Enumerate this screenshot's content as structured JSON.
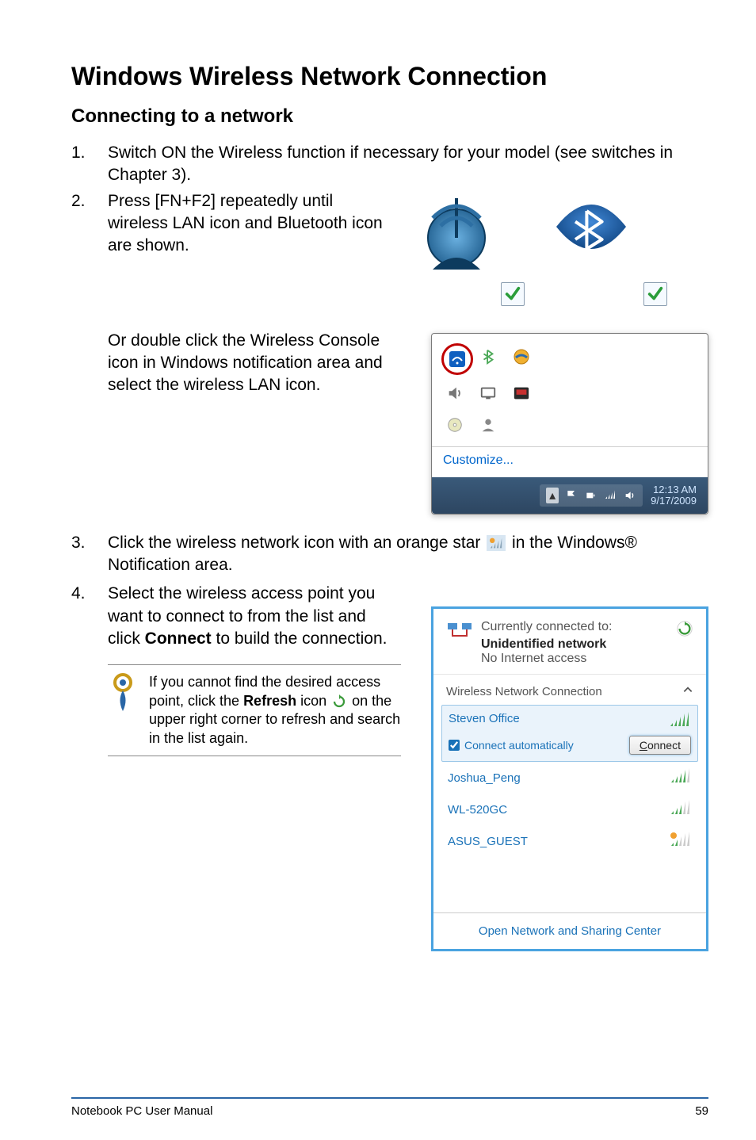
{
  "title": "Windows Wireless Network Connection",
  "subtitle": "Connecting to a network",
  "steps": {
    "s1_num": "1.",
    "s1_text": "Switch ON the Wireless function if necessary for your model (see switches in Chapter 3).",
    "s2_num": "2.",
    "s2_text": "Press [FN+F2] repeatedly until wireless LAN icon and Bluetooth icon are shown.",
    "s2_alt": "Or double click the Wireless Console icon in Windows notification area and select the wireless LAN icon.",
    "s3_num": "3.",
    "s3_text_before": "Click the wireless network icon with an orange star ",
    "s3_text_after": " in the Windows® Notification area.",
    "s4_num": "4.",
    "s4_text_a": "Select the wireless access point you want to connect to from the list and click ",
    "s4_bold": "Connect",
    "s4_text_b": " to build the connection."
  },
  "note": {
    "before": "If you cannot find the desired access point, click the ",
    "bold": "Refresh",
    "mid": " icon ",
    "after": " on the upper right corner to refresh and search in the list again."
  },
  "tray": {
    "customize": "Customize...",
    "time": "12:13 AM",
    "date": "9/17/2009"
  },
  "flyout": {
    "currently": "Currently connected to:",
    "unidentified": "Unidentified network",
    "noaccess": "No Internet access",
    "section": "Wireless Network Connection",
    "selected": "Steven Office",
    "auto_label": "Connect automatically",
    "connect_btn": "Connect",
    "items": [
      {
        "name": "Joshua_Peng"
      },
      {
        "name": "WL-520GC"
      },
      {
        "name": "ASUS_GUEST"
      }
    ],
    "footer": "Open Network and Sharing Center"
  },
  "page_footer": {
    "left": "Notebook PC User Manual",
    "right": "59"
  }
}
